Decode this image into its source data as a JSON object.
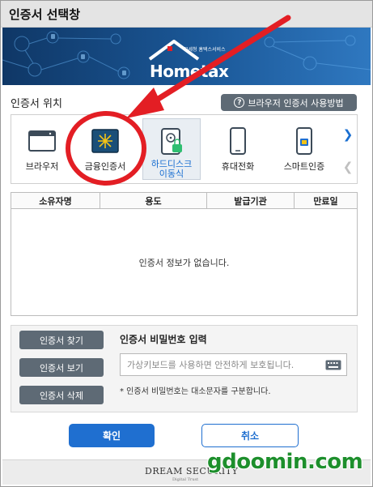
{
  "window": {
    "title": "인증서 선택창"
  },
  "banner": {
    "logo_text": "Hometax",
    "logo_subtitle": "국세청 홈택스서비스"
  },
  "location": {
    "label": "인증서 위치",
    "help_button": "브라우저 인증서 사용방법",
    "items": [
      {
        "label": "브라우저",
        "icon": "browser-icon",
        "selected": false
      },
      {
        "label": "금융인증서",
        "icon": "financial-cert-icon",
        "selected": false
      },
      {
        "label": "하드디스크\n이동식",
        "label_line1": "하드디스크",
        "label_line2": "이동식",
        "icon": "harddisk-icon",
        "selected": true
      },
      {
        "label": "휴대전화",
        "icon": "mobile-phone-icon",
        "selected": false
      },
      {
        "label": "스마트인증",
        "icon": "smart-cert-icon",
        "selected": false
      }
    ]
  },
  "table": {
    "headers": [
      "소유자명",
      "용도",
      "발급기관",
      "만료일"
    ],
    "rows": [],
    "empty_message": "인증서 정보가 없습니다."
  },
  "actions": {
    "find": "인증서 찾기",
    "view": "인증서 보기",
    "delete": "인증서 삭제"
  },
  "password": {
    "label": "인증서 비밀번호 입력",
    "placeholder": "가상키보드를 사용하면 안전하게 보호됩니다.",
    "value": "",
    "note": "* 인증서 비밀번호는 대소문자를 구분합니다."
  },
  "buttons": {
    "ok": "확인",
    "cancel": "취소"
  },
  "footer": {
    "vendor": "DREAM SECURITY",
    "vendor_tagline": "Digital Trust"
  },
  "watermark": "gdoomin.com",
  "colors": {
    "accent": "#1f6fd0",
    "annotation_red": "#e31e24",
    "button_gray": "#5e6a75",
    "watermark_green": "#1d8f2c"
  }
}
